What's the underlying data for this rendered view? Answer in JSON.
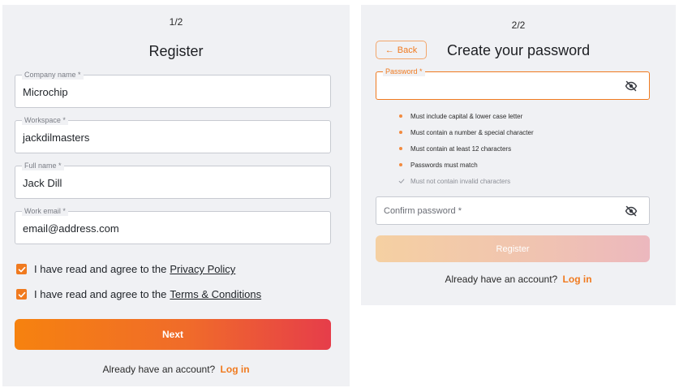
{
  "step1": {
    "step_label": "1/2",
    "title": "Register",
    "fields": [
      {
        "label": "Company name *",
        "value": "Microchip"
      },
      {
        "label": "Workspace *",
        "value": "jackdilmasters"
      },
      {
        "label": "Full name *",
        "value": "Jack Dill"
      },
      {
        "label": "Work email *",
        "value": "email@address.com"
      }
    ],
    "checks": [
      {
        "text": "I have read and agree to the",
        "link": "Privacy Policy",
        "checked": true
      },
      {
        "text": "I have read and agree to the",
        "link": "Terms & Conditions",
        "checked": true
      }
    ],
    "next_label": "Next",
    "account_text": "Already have an account?",
    "login_label": "Log in"
  },
  "step2": {
    "step_label": "2/2",
    "back_label": "Back",
    "title": "Create your password",
    "password_label": "Password *",
    "requirements": [
      {
        "text": "Must include capital & lower case letter",
        "met": false
      },
      {
        "text": "Must contain a number & special character",
        "met": false
      },
      {
        "text": "Must contain at least 12 characters",
        "met": false
      },
      {
        "text": "Passwords must match",
        "met": false
      },
      {
        "text": "Must not contain invalid characters",
        "met": true
      }
    ],
    "confirm_placeholder": "Confirm password *",
    "register_label": "Register",
    "account_text": "Already have an account?",
    "login_label": "Log in"
  },
  "colors": {
    "accent": "#f07a1f",
    "gradient_start": "#f6820f",
    "gradient_end": "#e63d4a",
    "panel_bg": "#f0f1f4"
  },
  "icons": {
    "checkbox": "check-icon",
    "password_toggle": "eye-off-icon",
    "back": "arrow-left-icon"
  }
}
